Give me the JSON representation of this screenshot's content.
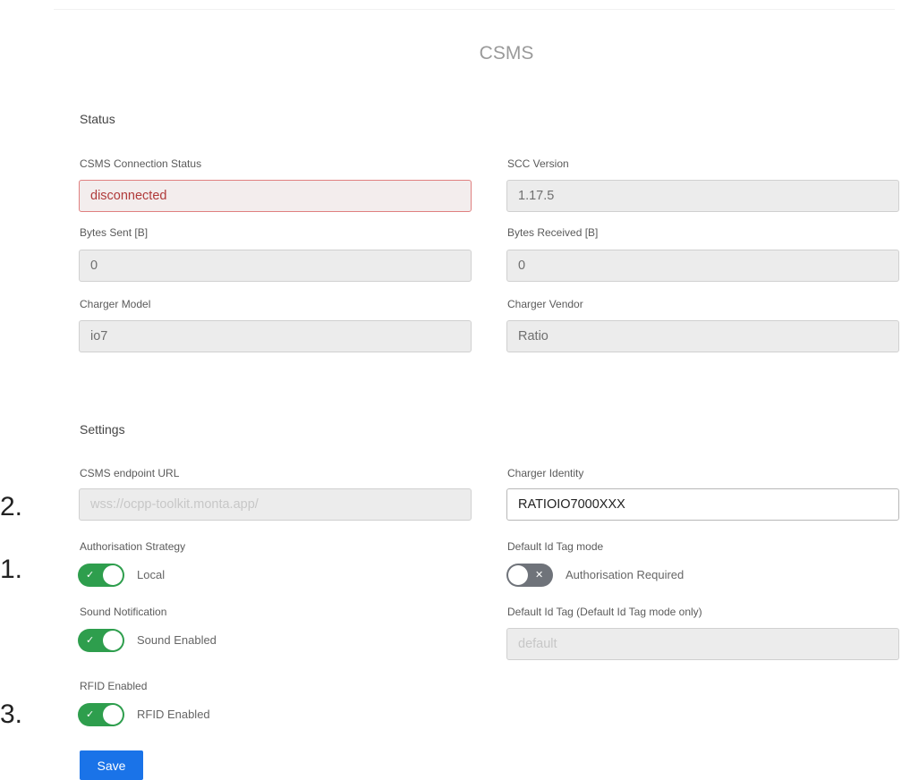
{
  "page": {
    "title": "CSMS"
  },
  "status": {
    "heading": "Status",
    "connection_status": {
      "label": "CSMS Connection Status",
      "value": "disconnected"
    },
    "scc_version": {
      "label": "SCC Version",
      "value": "1.17.5"
    },
    "bytes_sent": {
      "label": "Bytes Sent [B]",
      "value": "0"
    },
    "bytes_received": {
      "label": "Bytes Received [B]",
      "value": "0"
    },
    "charger_model": {
      "label": "Charger Model",
      "value": "io7"
    },
    "charger_vendor": {
      "label": "Charger Vendor",
      "value": "Ratio"
    }
  },
  "settings": {
    "heading": "Settings",
    "endpoint_url": {
      "label": "CSMS endpoint URL",
      "placeholder": "wss://ocpp-toolkit.monta.app/"
    },
    "charger_identity": {
      "label": "Charger Identity",
      "value": "RATIOIO7000XXX"
    },
    "auth_strategy": {
      "label": "Authorisation Strategy",
      "toggle_text": "Local",
      "enabled": true
    },
    "default_id_tag_mode": {
      "label": "Default Id Tag mode",
      "toggle_text": "Authorisation Required",
      "enabled": false
    },
    "sound_notification": {
      "label": "Sound Notification",
      "toggle_text": "Sound Enabled",
      "enabled": true
    },
    "default_id_tag": {
      "label": "Default Id Tag (Default Id Tag mode only)",
      "placeholder": "default"
    },
    "rfid": {
      "label": "RFID Enabled",
      "toggle_text": "RFID Enabled",
      "enabled": true
    },
    "save_label": "Save"
  },
  "markers": {
    "one": "1.",
    "two": "2.",
    "three": "3."
  },
  "icons": {
    "toggle_on": "check-icon",
    "toggle_off": "x-icon"
  },
  "colors": {
    "accent": "#1a73e8",
    "toggle_on": "#2e9e4d",
    "toggle_off": "#6f737a",
    "error": "#b03a3a"
  }
}
